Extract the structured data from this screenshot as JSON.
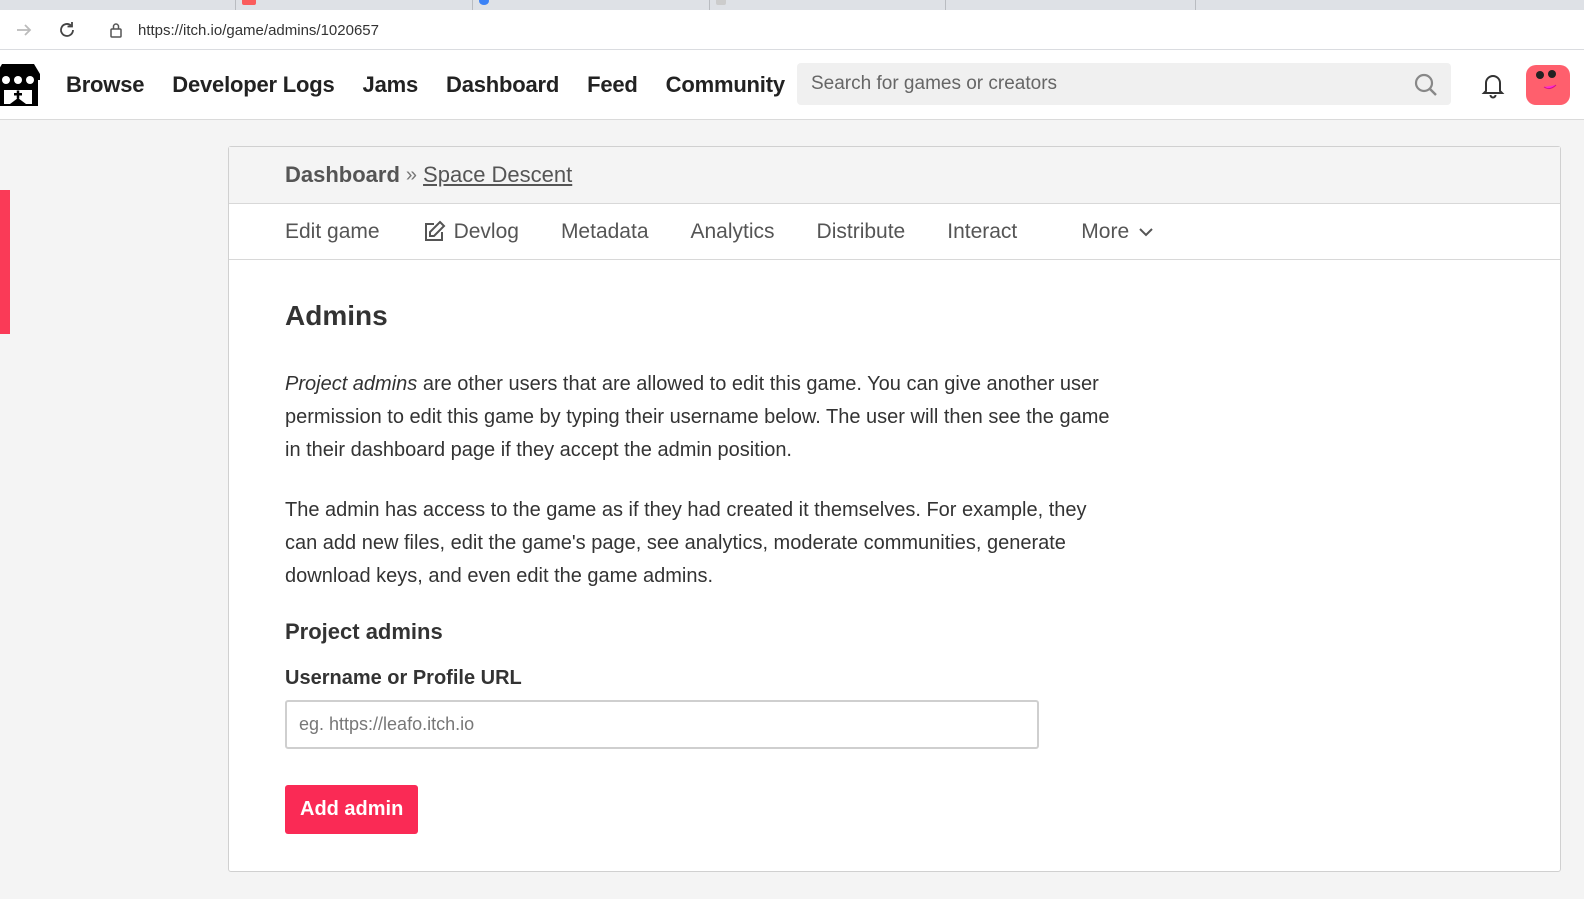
{
  "browser": {
    "url": "https://itch.io/game/admins/1020657"
  },
  "header": {
    "nav": [
      "Browse",
      "Developer Logs",
      "Jams",
      "Dashboard",
      "Feed",
      "Community"
    ],
    "search_placeholder": "Search for games or creators"
  },
  "breadcrumb": {
    "dashboard": "Dashboard",
    "separator": "»",
    "game": "Space Descent"
  },
  "subnav": {
    "edit_game": "Edit game",
    "devlog": "Devlog",
    "metadata": "Metadata",
    "analytics": "Analytics",
    "distribute": "Distribute",
    "interact": "Interact",
    "more": "More"
  },
  "content": {
    "title": "Admins",
    "para1_em": "Project admins",
    "para1_rest": " are other users that are allowed to edit this game. You can give another user permission to edit this game by typing their username below. The user will then see the game in their dashboard page if they accept the admin position.",
    "para2": "The admin has access to the game as if they had created it themselves. For example, they can add new files, edit the game's page, see analytics, moderate communities, generate download keys, and even edit the game admins.",
    "section_title": "Project admins",
    "field_label": "Username or Profile URL",
    "field_placeholder": "eg. https://leafo.itch.io",
    "field_value": "",
    "add_button": "Add admin"
  },
  "colors": {
    "accent": "#fa2a55",
    "marker": "#fa3a57"
  }
}
